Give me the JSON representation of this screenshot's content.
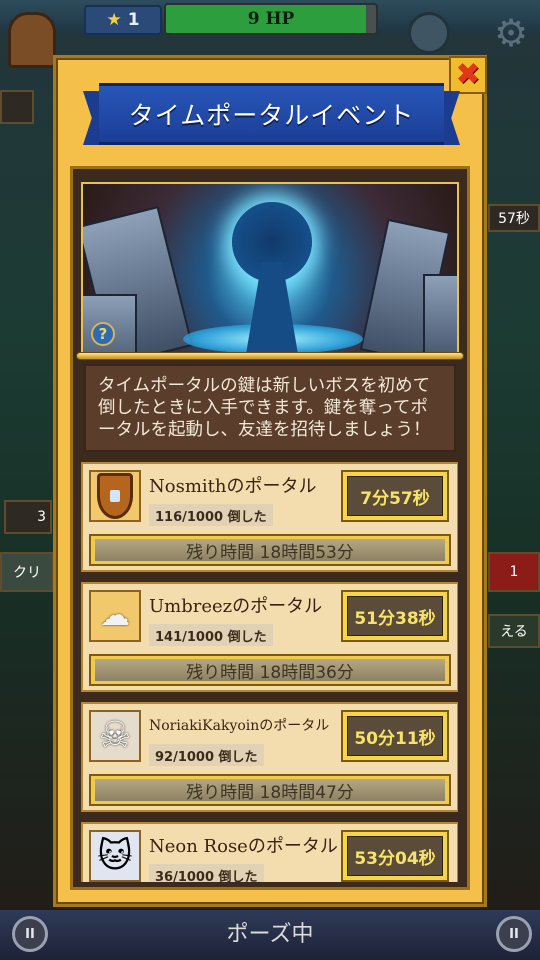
{
  "hud": {
    "stars": "1",
    "hp_text": "9 HP",
    "hp_fraction": 0.95,
    "side_count_left": "3",
    "side_tag_right": "1",
    "side_timer": "57秒",
    "side_label": "クリ",
    "side_right_label": "える"
  },
  "modal": {
    "title": "タイムポータルイベント",
    "close_label": "✖",
    "help_label": "?",
    "description": "タイムポータルの鍵は新しいボスを初めて倒したときに入手できます。鍵を奪ってポータルを起動し、友達を招待しましょう！",
    "portals": [
      {
        "name": "Nosmithのポータル",
        "icon": "shield-icon",
        "progress": "116/1000 倒した",
        "timer": "7分57秒",
        "remaining": "残り時間 18時間53分",
        "small": false
      },
      {
        "name": "Umbreezのポータル",
        "icon": "storm-cloud-icon",
        "progress": "141/1000 倒した",
        "timer": "51分38秒",
        "remaining": "残り時間 18時間36分",
        "small": false
      },
      {
        "name": "NoriakiKakyoinのポータル",
        "icon": "skull-icon",
        "progress": "92/1000 倒した",
        "timer": "50分11秒",
        "remaining": "残り時間 18時間47分",
        "small": true
      },
      {
        "name": "Neon Roseのポータル",
        "icon": "cat-icon",
        "progress": "36/1000 倒した",
        "timer": "53分04秒",
        "remaining": "",
        "small": false
      }
    ]
  },
  "footer": {
    "pause_text": "ポーズ中",
    "pause_icon": "II"
  },
  "colors": {
    "modal_gold": "#f4c04a",
    "banner_blue": "#2856b8",
    "timer_text": "#f8e36a",
    "close_red": "#e23818"
  }
}
